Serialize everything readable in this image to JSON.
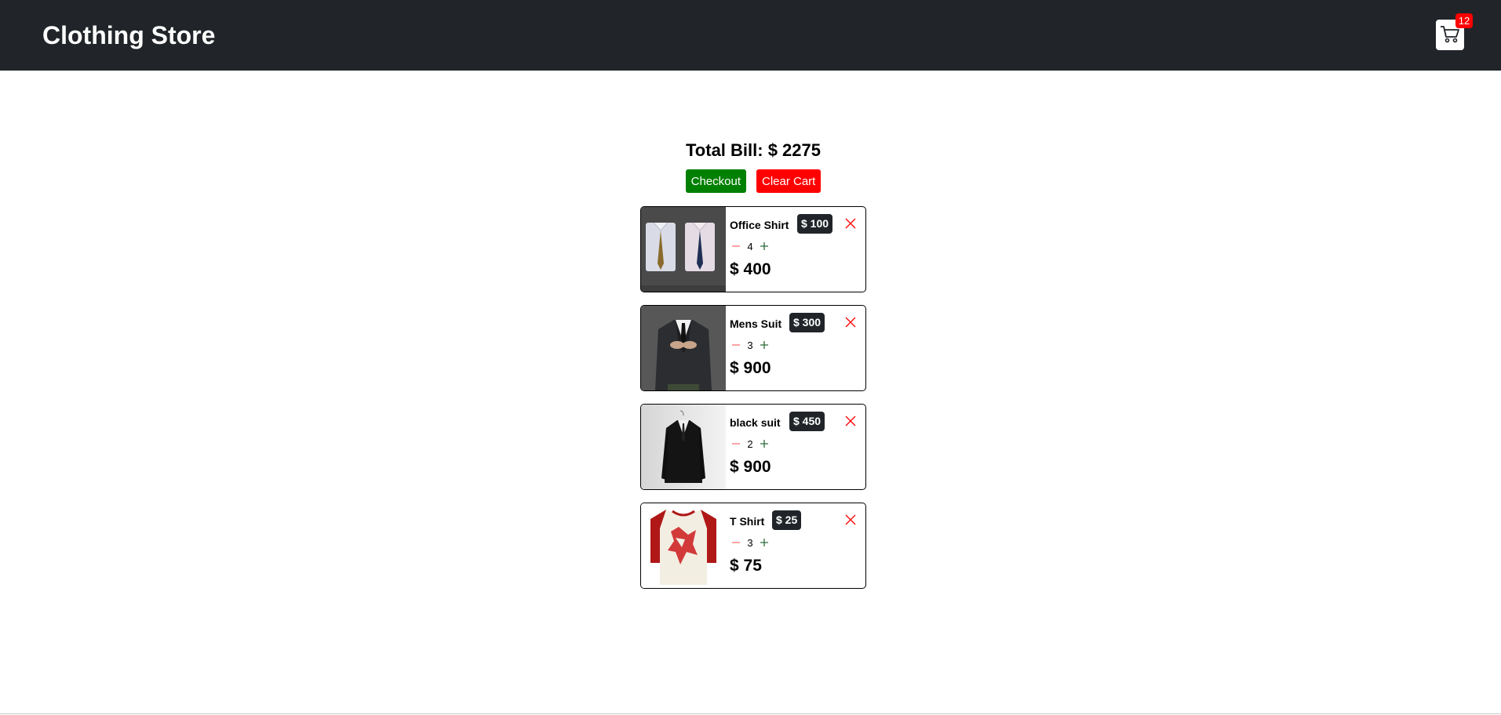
{
  "header": {
    "title": "Clothing Store",
    "cart_icon": "cart-icon",
    "cart_count": "12"
  },
  "summary": {
    "total_label": "Total Bill: $ 2275",
    "checkout_label": "Checkout",
    "clear_label": "Clear Cart"
  },
  "items": [
    {
      "name": "Office Shirt",
      "price": "$ 100",
      "quantity": "4",
      "subtotal": "$ 400"
    },
    {
      "name": "Mens Suit",
      "price": "$ 300",
      "quantity": "3",
      "subtotal": "$ 900"
    },
    {
      "name": "black suit",
      "price": "$ 450",
      "quantity": "2",
      "subtotal": "$ 900"
    },
    {
      "name": "T Shirt",
      "price": "$ 25",
      "quantity": "3",
      "subtotal": "$ 75"
    }
  ],
  "colors": {
    "navbar": "#212529",
    "checkout": "#008000",
    "clear": "#ff0000",
    "remove": "#ff0000"
  }
}
